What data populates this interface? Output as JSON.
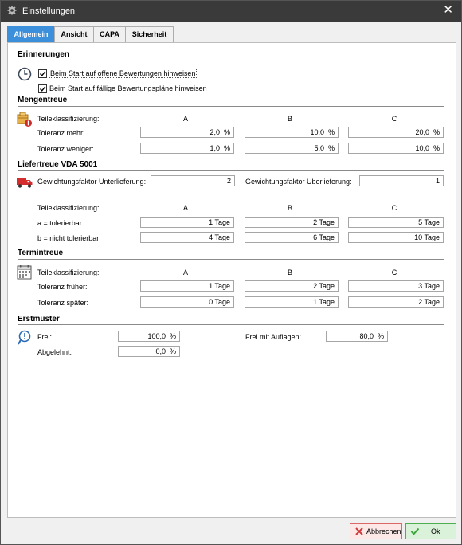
{
  "window": {
    "title": "Einstellungen",
    "close_glyph": "✕",
    "icon": "gear-icon"
  },
  "tabs": [
    {
      "label": "Allgemein",
      "active": true
    },
    {
      "label": "Ansicht",
      "active": false
    },
    {
      "label": "CAPA",
      "active": false
    },
    {
      "label": "Sicherheit",
      "active": false
    }
  ],
  "reminders": {
    "title": "Erinnerungen",
    "icon": "clock-icon",
    "checkbox1": {
      "label": "Beim Start auf offene Bewertungen hinweisen",
      "checked": true
    },
    "checkbox2": {
      "label": "Beim Start auf fällige Bewertungspläne hinweisen",
      "checked": true
    }
  },
  "quantity": {
    "title": "Mengentreue",
    "icon": "box-warning-icon",
    "class_label": "Teileklassifizierung:",
    "headers": [
      "A",
      "B",
      "C"
    ],
    "rows": [
      {
        "label": "Toleranz mehr:",
        "values": [
          "2,0  %",
          "10,0  %",
          "20,0  %"
        ]
      },
      {
        "label": "Toleranz weniger:",
        "values": [
          "1,0  %",
          "5,0  %",
          "10,0  %"
        ]
      }
    ]
  },
  "delivery": {
    "title": "Liefertreue VDA 5001",
    "icon": "truck-icon",
    "under_label": "Gewichtungsfaktor Unterlieferung:",
    "under_value": "2",
    "over_label": "Gewichtungsfaktor Überlieferung:",
    "over_value": "1",
    "class_label": "Teileklassifizierung:",
    "headers": [
      "A",
      "B",
      "C"
    ],
    "rows": [
      {
        "label": "a = tolerierbar:",
        "values": [
          "1 Tage",
          "2 Tage",
          "5 Tage"
        ]
      },
      {
        "label": "b = nicht tolerierbar:",
        "values": [
          "4 Tage",
          "6 Tage",
          "10 Tage"
        ]
      }
    ]
  },
  "schedule": {
    "title": "Termintreue",
    "icon": "calendar-icon",
    "class_label": "Teileklassifizierung:",
    "headers": [
      "A",
      "B",
      "C"
    ],
    "rows": [
      {
        "label": "Toleranz früher:",
        "values": [
          "1 Tage",
          "2 Tage",
          "3 Tage"
        ]
      },
      {
        "label": "Toleranz später:",
        "values": [
          "0 Tage",
          "1 Tage",
          "2 Tage"
        ]
      }
    ]
  },
  "first_sample": {
    "title": "Erstmuster",
    "icon": "pin-warning-icon",
    "free_label": "Frei:",
    "free_value": "100,0  %",
    "rejected_label": "Abgelehnt:",
    "rejected_value": "0,0  %",
    "conditional_label": "Frei mit Auflagen:",
    "conditional_value": "80,0  %"
  },
  "buttons": {
    "cancel": {
      "label": "Abbrechen",
      "icon": "x-icon",
      "accent": "#d03a3a"
    },
    "ok": {
      "label": "Ok",
      "icon": "check-icon",
      "accent": "#3aa43a"
    }
  }
}
